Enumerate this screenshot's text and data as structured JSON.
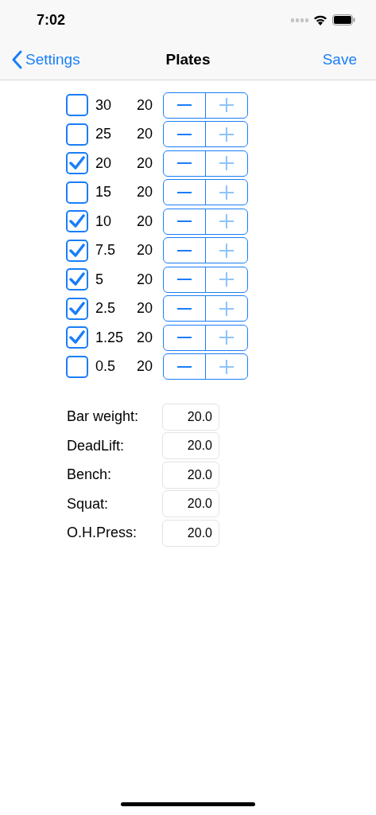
{
  "status_bar": {
    "time": "7:02"
  },
  "nav": {
    "back": "Settings",
    "title": "Plates",
    "action": "Save"
  },
  "plates": [
    {
      "weight": "30",
      "count": "20",
      "checked": false,
      "plus_disabled": true
    },
    {
      "weight": "25",
      "count": "20",
      "checked": false,
      "plus_disabled": true
    },
    {
      "weight": "20",
      "count": "20",
      "checked": true,
      "plus_disabled": true
    },
    {
      "weight": "15",
      "count": "20",
      "checked": false,
      "plus_disabled": true
    },
    {
      "weight": "10",
      "count": "20",
      "checked": true,
      "plus_disabled": true
    },
    {
      "weight": "7.5",
      "count": "20",
      "checked": true,
      "plus_disabled": true
    },
    {
      "weight": "5",
      "count": "20",
      "checked": true,
      "plus_disabled": true
    },
    {
      "weight": "2.5",
      "count": "20",
      "checked": true,
      "plus_disabled": true
    },
    {
      "weight": "1.25",
      "count": "20",
      "checked": true,
      "plus_disabled": true
    },
    {
      "weight": "0.5",
      "count": "20",
      "checked": false,
      "plus_disabled": true
    }
  ],
  "weights": [
    {
      "label": "Bar weight:",
      "value": "20.0"
    },
    {
      "label": "DeadLift:",
      "value": "20.0"
    },
    {
      "label": "Bench:",
      "value": "20.0"
    },
    {
      "label": "Squat:",
      "value": "20.0"
    },
    {
      "label": "O.H.Press:",
      "value": "20.0"
    }
  ]
}
